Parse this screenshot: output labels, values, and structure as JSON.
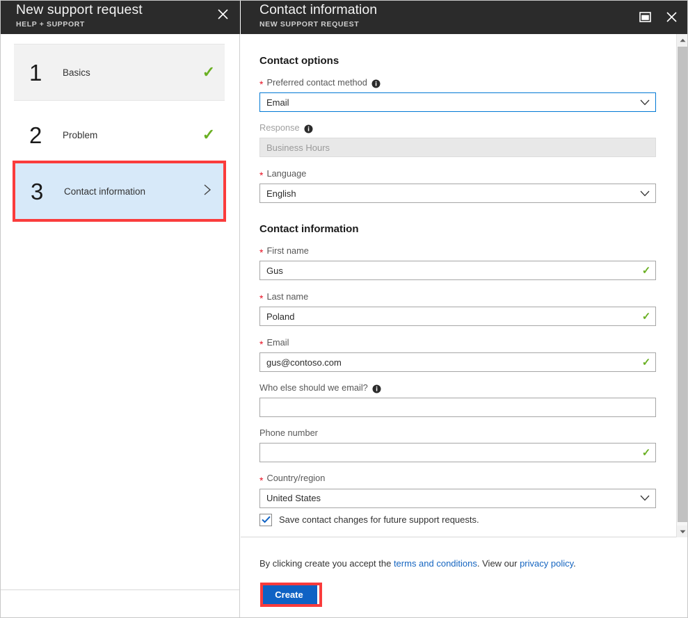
{
  "left_blade": {
    "title": "New support request",
    "subtitle": "HELP + SUPPORT",
    "close_icon": "close-icon",
    "steps": [
      {
        "number": "1",
        "label": "Basics",
        "status_icon": "checkmark-icon",
        "state": "completed"
      },
      {
        "number": "2",
        "label": "Problem",
        "status_icon": "checkmark-icon",
        "state": "completed"
      },
      {
        "number": "3",
        "label": "Contact information",
        "status_icon": "chevron-right-icon",
        "state": "selected"
      }
    ]
  },
  "right_blade": {
    "title": "Contact information",
    "subtitle": "NEW SUPPORT REQUEST",
    "maximize_icon": "maximize-icon",
    "close_icon": "close-icon"
  },
  "contact_options": {
    "heading": "Contact options",
    "preferred_contact_method": {
      "label": "Preferred contact method",
      "required": "*",
      "info_icon": "info-icon",
      "value": "Email",
      "chevron_icon": "chevron-down-icon",
      "focused": true
    },
    "response": {
      "label": "Response",
      "info_icon": "info-icon",
      "value": "Business Hours",
      "disabled": true
    },
    "language": {
      "label": "Language",
      "required": "*",
      "value": "English",
      "chevron_icon": "chevron-down-icon"
    }
  },
  "contact_information": {
    "heading": "Contact information",
    "first_name": {
      "label": "First name",
      "required": "*",
      "value": "Gus",
      "valid_icon": "checkmark-icon"
    },
    "last_name": {
      "label": "Last name",
      "required": "*",
      "value": "Poland",
      "valid_icon": "checkmark-icon"
    },
    "email": {
      "label": "Email",
      "required": "*",
      "value": "gus@contoso.com",
      "valid_icon": "checkmark-icon"
    },
    "additional_email": {
      "label": "Who else should we email?",
      "info_icon": "info-icon",
      "value": "",
      "placeholder": ""
    },
    "phone_number": {
      "label": "Phone number",
      "value": "",
      "placeholder": "",
      "valid_icon": "checkmark-icon"
    },
    "country_region": {
      "label": "Country/region",
      "required": "*",
      "value": "United States",
      "chevron_icon": "chevron-down-icon"
    },
    "save_contact": {
      "label": "Save contact changes for future support requests.",
      "checked": true,
      "check_icon": "checkmark-icon"
    }
  },
  "footer": {
    "terms_prefix": "By clicking create you accept the ",
    "terms_link": "terms and conditions",
    "terms_middle": ". View our ",
    "privacy_link": "privacy policy",
    "terms_suffix": ".",
    "create_label": "Create"
  },
  "scrollbar": {
    "up_icon": "scroll-up-arrow-icon",
    "down_icon": "scroll-down-arrow-icon",
    "thumb": "scroll-thumb"
  },
  "colors": {
    "header_bg": "#2b2b2b",
    "accent_blue": "#0f62c4",
    "focus_blue": "#0078d4",
    "selected_step_bg": "#d7e9f9",
    "highlight_red": "#fa3c3c",
    "valid_green": "#6ab023",
    "required_red": "#e81123",
    "link_blue": "#1565c0"
  }
}
